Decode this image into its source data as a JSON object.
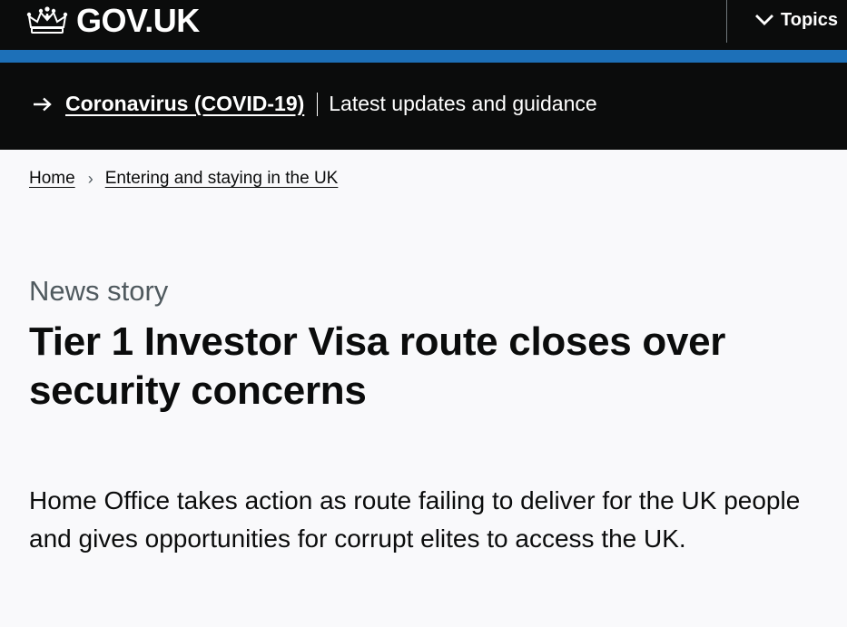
{
  "header": {
    "logo_text": "GOV.UK",
    "topics_label": "Topics"
  },
  "covid_banner": {
    "link_text": "Coronavirus (COVID-19)",
    "text": "Latest updates and guidance"
  },
  "breadcrumb": [
    {
      "label": "Home"
    },
    {
      "label": "Entering and staying in the UK"
    }
  ],
  "article": {
    "caption": "News story",
    "title": "Tier 1 Investor Visa route closes over security concerns",
    "lede": "Home Office takes action as route failing to deliver for the UK people and gives opportunities for corrupt elites to access the UK."
  },
  "icons": {
    "logo": "crown-icon",
    "topics": "chevron-down-icon",
    "banner": "arrow-right-icon",
    "breadcrumb_separator": "chevron-right-icon"
  },
  "colors": {
    "header_bg": "#0b0c0c",
    "accent_blue": "#1d70b8",
    "page_bg": "#f9f9fb",
    "text": "#0b0c0c",
    "secondary_text": "#505a5f"
  }
}
